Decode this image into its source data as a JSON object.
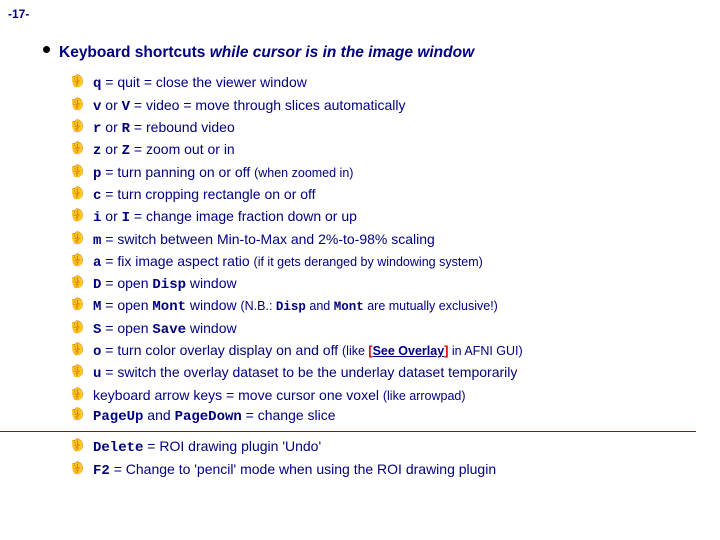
{
  "pageNumber": "-17-",
  "heading": {
    "plain": "Keyboard shortcuts ",
    "italic": "while cursor is in the image window"
  },
  "items": [
    {
      "html": "<span class='code'>q</span> = quit = close the viewer window"
    },
    {
      "html": "<span class='code'>v</span> or <span class='code'>V</span> = video = move through slices automatically"
    },
    {
      "html": "<span class='code'>r</span> or <span class='code'>R</span> = rebound video"
    },
    {
      "html": "<span class='code'>z</span> or <span class='code'>Z</span> = zoom out or in"
    },
    {
      "html": "<span class='code'>p</span> = turn panning on or off <span class='smallnote'>(when zoomed in)</span>"
    },
    {
      "html": "<span class='code'>c</span> = turn cropping rectangle on or off"
    },
    {
      "html": "<span class='code'>i</span> or <span class='code'>I</span> = change image fraction down or up"
    },
    {
      "html": "<span class='code'>m</span> = switch between Min-to-Max and 2%-to-98% scaling"
    },
    {
      "html": "<span class='code'>a</span> = fix image aspect ratio <span class='smallnote'>(if it gets deranged by windowing system)</span>"
    },
    {
      "html": "<span class='code'>D</span> = open <span class='code'>Disp</span> window"
    },
    {
      "html": "<span class='code'>M</span> = open <span class='code'>Mont</span> window <span class='smallnote'>(N.B.: <span class='code'>Disp</span> and <span class='code'>Mont</span> are mutually exclusive!)</span>"
    },
    {
      "html": "<span class='code'>S</span> = open <span class='code'>Save</span> window"
    },
    {
      "html": "<span class='code'>o</span> = turn color overlay display on and off <span class='smallnote'>(like <span class='red'>[</span><span class='link'>See Overlay</span><span class='red'>]</span> in AFNI GUI)</span>"
    },
    {
      "html": "<span class='code'>u</span> = switch the overlay dataset to be the underlay dataset temporarily"
    },
    {
      "html": "keyboard arrow keys = move cursor one voxel <span class='smallnote'>(like arrowpad)</span>"
    },
    {
      "html": "<span class='code'>PageUp</span> and <span class='code'>PageDown</span> = change slice"
    }
  ],
  "itemsAfter": [
    {
      "html": "<span class='code'>Delete</span> = ROI drawing plugin 'Undo'"
    },
    {
      "html": "<span class='code'>F2</span> = Change to 'pencil' mode when using the ROI drawing plugin"
    }
  ]
}
